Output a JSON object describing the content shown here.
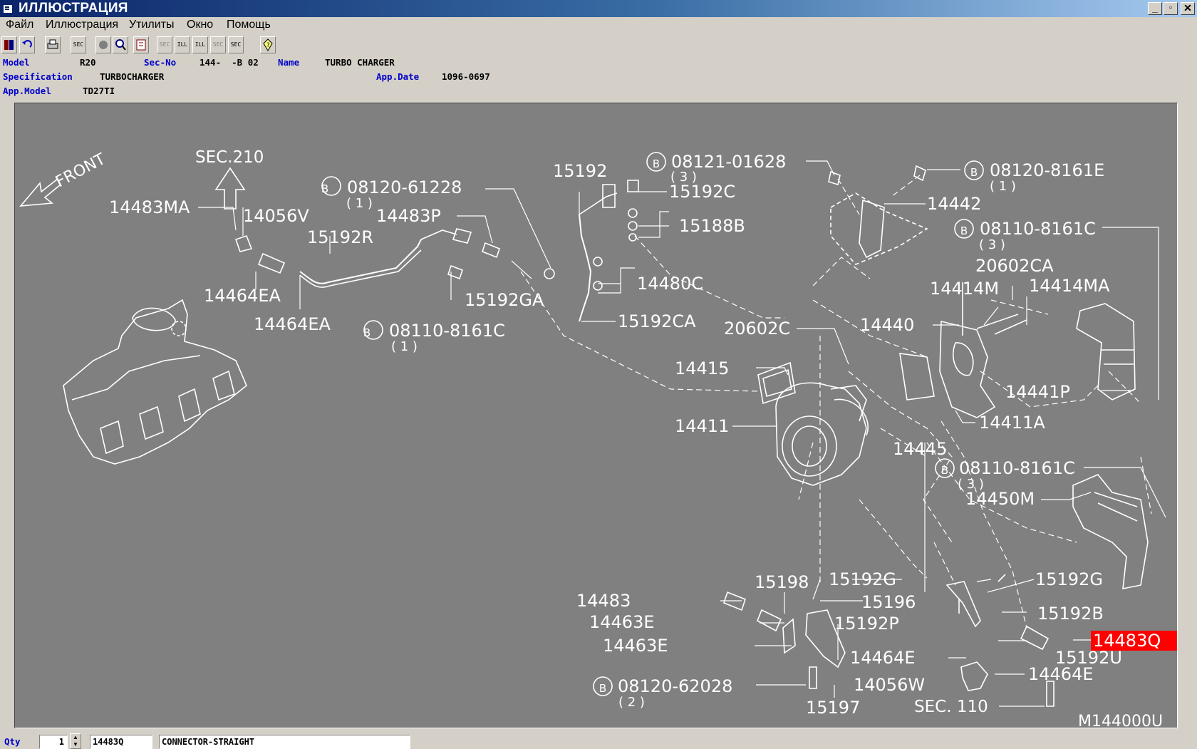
{
  "window": {
    "title": "ИЛЛЮСТРАЦИЯ",
    "min_glyph": "_",
    "max_glyph": "▫",
    "close_glyph": "✕"
  },
  "menu": {
    "items": [
      "Файл",
      "Иллюстрация",
      "Утилиты",
      "Окно",
      "Помощь"
    ]
  },
  "toolbar": {
    "buttons": [
      "exit-book",
      "undo",
      "print",
      "sec-list",
      "circle",
      "zoom",
      "book",
      "sec-prev",
      "ill-prev",
      "ill-next",
      "sec-next",
      "sec-search",
      "help"
    ],
    "labels": {
      "sec": "SEC",
      "ill": "ILL",
      "sec2": "SEC"
    }
  },
  "info": {
    "model_label": "Model",
    "model_value": "R20",
    "secno_label": "Sec-No",
    "secno_value": "144-  -B 02",
    "name_label": "Name",
    "name_value": "TURBO CHARGER",
    "spec_label": "Specification",
    "spec_value": "TURBOCHARGER",
    "appdate_label": "App.Date",
    "appdate_value": "1096-0697",
    "appmodel_label": "App.Model",
    "appmodel_value": "TD27TI"
  },
  "illustration": {
    "front_label": "FRONT",
    "sec_top": "SEC.210",
    "sec_bottom": "SEC. 110",
    "drawing_id": "M144000U",
    "selected_part": "14483Q",
    "highlight_color": "#ff0000",
    "bg_color": "#808080",
    "line_color": "#ffffff",
    "b_symbol": "B",
    "callouts": {
      "p14483MA": "14483MA",
      "p14056V": "14056V",
      "p15192R": "15192R",
      "p14464EA_1": "14464EA",
      "p14464EA_2": "14464EA",
      "b0812061228": "08120-61228",
      "q1_a": "( 1 )",
      "p14483P": "14483P",
      "p15192GA": "15192GA",
      "b08110_1": "08110-8161C",
      "q1_b": "( 1 )",
      "p15192": "15192",
      "p15192C": "15192C",
      "p15188B": "15188B",
      "p14480C": "14480C",
      "p15192CA": "15192CA",
      "b0812101628": "08121-01628",
      "q3_a": "( 3 )",
      "b0812081161E": "08120-8161E",
      "q1_c": "( 1 )",
      "p14442": "14442",
      "b08110_3a": "08110-8161C",
      "q3_b": "( 3 )",
      "p20602CA": "20602CA",
      "p14414M": "14414M",
      "p14414MA": "14414MA",
      "p14440": "14440",
      "p20602C": "20602C",
      "p14415": "14415",
      "p14441P": "14441P",
      "p14411": "14411",
      "p14411A": "14411A",
      "p14445": "14445",
      "b08110_3b": "08110-8161C",
      "q3_c": "( 3 )",
      "p14450M": "14450M",
      "p15198": "15198",
      "p15192G_1": "15192G",
      "p15192G_2": "15192G",
      "p14483": "14483",
      "p15196": "15196",
      "p14463E_1": "14463E",
      "p15192B": "15192B",
      "p15192P": "15192P",
      "p14463E_2": "14463E",
      "p15192U": "15192U",
      "p14464E_1": "14464E",
      "p14464E_2": "14464E",
      "p14056W": "14056W",
      "b0812062028": "08120-62028",
      "q2": "( 2 )",
      "p15197": "15197"
    }
  },
  "status": {
    "qty_label": "Qty",
    "qty_value": "1",
    "part_no": "14483Q",
    "part_name": "CONNECTOR-STRAIGHT"
  }
}
